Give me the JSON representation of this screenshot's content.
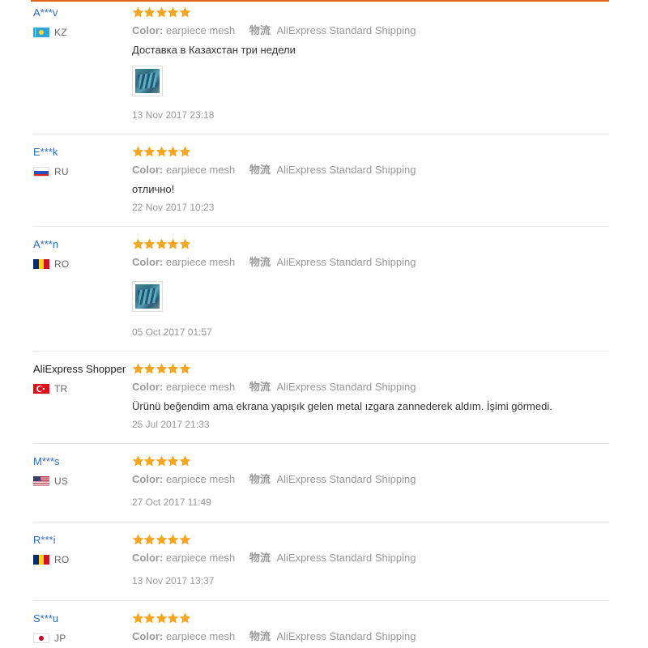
{
  "colors": {
    "accent_rule": "#e46212",
    "buyer_link": "#2d6bbf",
    "star": "#f5a623",
    "meta_text": "#999999",
    "body_text": "#333333",
    "divider": "#e8e8e8"
  },
  "labels": {
    "color_label": "Color:",
    "shipping_label": "物流"
  },
  "reviews": [
    {
      "buyer": "A***v",
      "country": "KZ",
      "flag": "kz-flag-icon",
      "rating": 5,
      "color": "earpiece mesh",
      "shipping": "AliExpress Standard Shipping",
      "feedback": "Доставка в Казахстан три недели",
      "has_photo": true,
      "date": "13 Nov 2017 23:18"
    },
    {
      "buyer": "E***k",
      "country": "RU",
      "flag": "ru-flag-icon",
      "rating": 5,
      "color": "earpiece mesh",
      "shipping": "AliExpress Standard Shipping",
      "feedback": "отлично!",
      "has_photo": false,
      "date": "22 Nov 2017 10:23"
    },
    {
      "buyer": "A***n",
      "country": "RO",
      "flag": "ro-flag-icon",
      "rating": 5,
      "color": "earpiece mesh",
      "shipping": "AliExpress Standard Shipping",
      "feedback": "",
      "has_photo": true,
      "date": "05 Oct 2017 01:57"
    },
    {
      "buyer": "AliExpress Shopper",
      "country": "TR",
      "flag": "tr-flag-icon",
      "rating": 5,
      "color": "earpiece mesh",
      "shipping": "AliExpress Standard Shipping",
      "feedback": "Ürünü beğendim ama ekrana yapışık gelen metal ızgara zannederek aldım. İşimi görmedi.",
      "has_photo": false,
      "date": "25 Jul 2017 21:33"
    },
    {
      "buyer": "M***s",
      "country": "US",
      "flag": "us-flag-icon",
      "rating": 5,
      "color": "earpiece mesh",
      "shipping": "AliExpress Standard Shipping",
      "feedback": "",
      "has_photo": false,
      "date": "27 Oct 2017 11:49"
    },
    {
      "buyer": "R***i",
      "country": "RO",
      "flag": "ro-flag-icon",
      "rating": 5,
      "color": "earpiece mesh",
      "shipping": "AliExpress Standard Shipping",
      "feedback": "",
      "has_photo": false,
      "date": "13 Nov 2017 13:37"
    },
    {
      "buyer": "S***u",
      "country": "JP",
      "flag": "jp-flag-icon",
      "rating": 5,
      "color": "earpiece mesh",
      "shipping": "AliExpress Standard Shipping",
      "feedback": "",
      "has_photo": false,
      "date": ""
    }
  ]
}
